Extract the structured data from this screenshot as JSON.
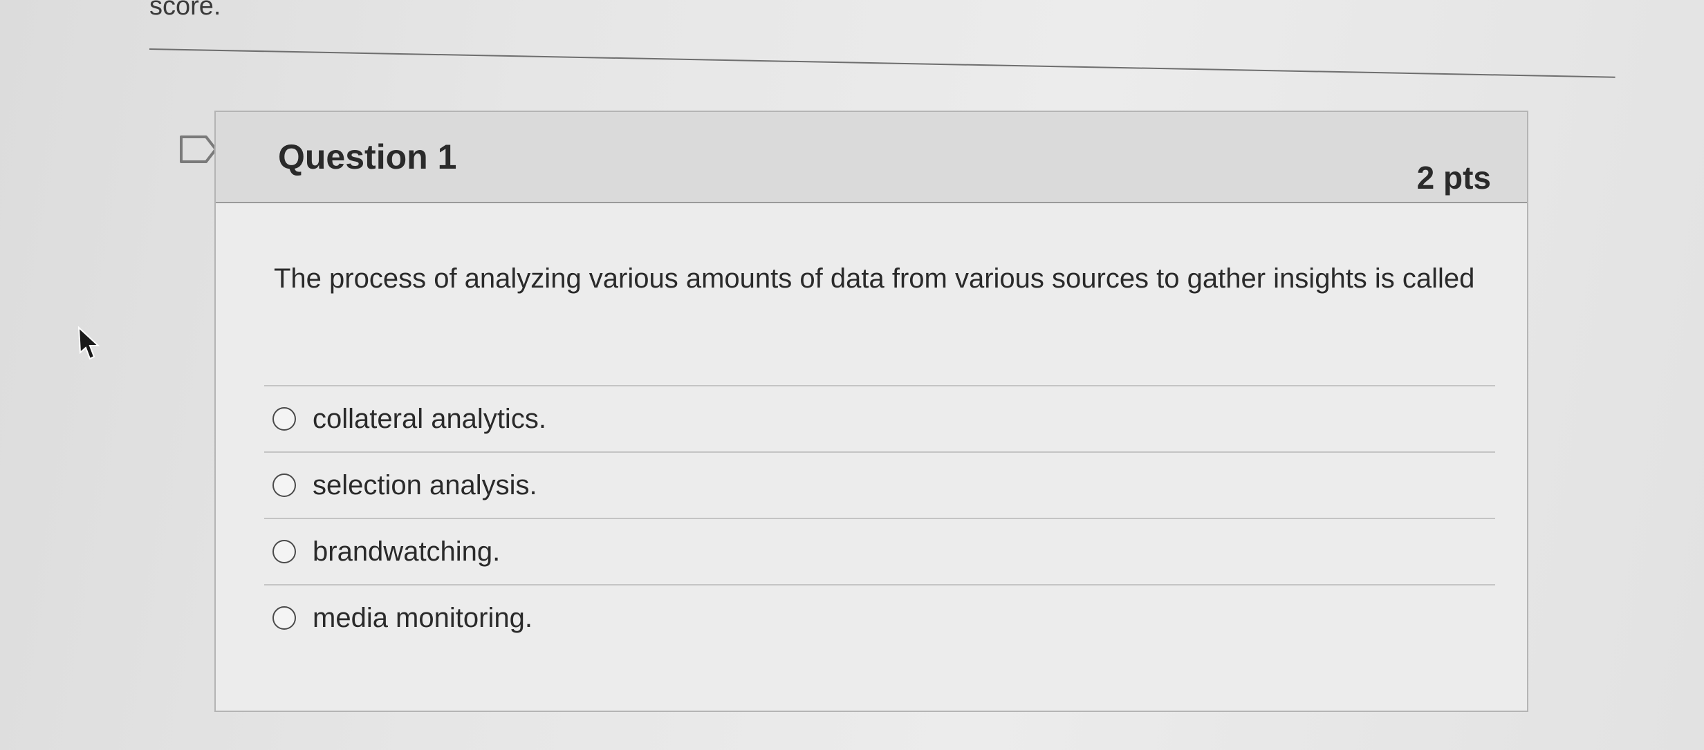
{
  "page": {
    "top_text": "score."
  },
  "question": {
    "title": "Question 1",
    "points": "2 pts",
    "text": "The process of analyzing various amounts of data from various sources to gather insights is called",
    "flag_icon": "flag-outline-icon",
    "answers": [
      {
        "label": "collateral analytics.",
        "selected": false
      },
      {
        "label": "selection analysis.",
        "selected": false
      },
      {
        "label": "brandwatching.",
        "selected": false
      },
      {
        "label": "media monitoring.",
        "selected": false
      }
    ]
  },
  "cursor_icon": "mouse-pointer-icon",
  "colors": {
    "header_bg": "#dadada",
    "card_bg": "#ececec",
    "border": "#b4b4b4",
    "text": "#2a2a2a"
  }
}
